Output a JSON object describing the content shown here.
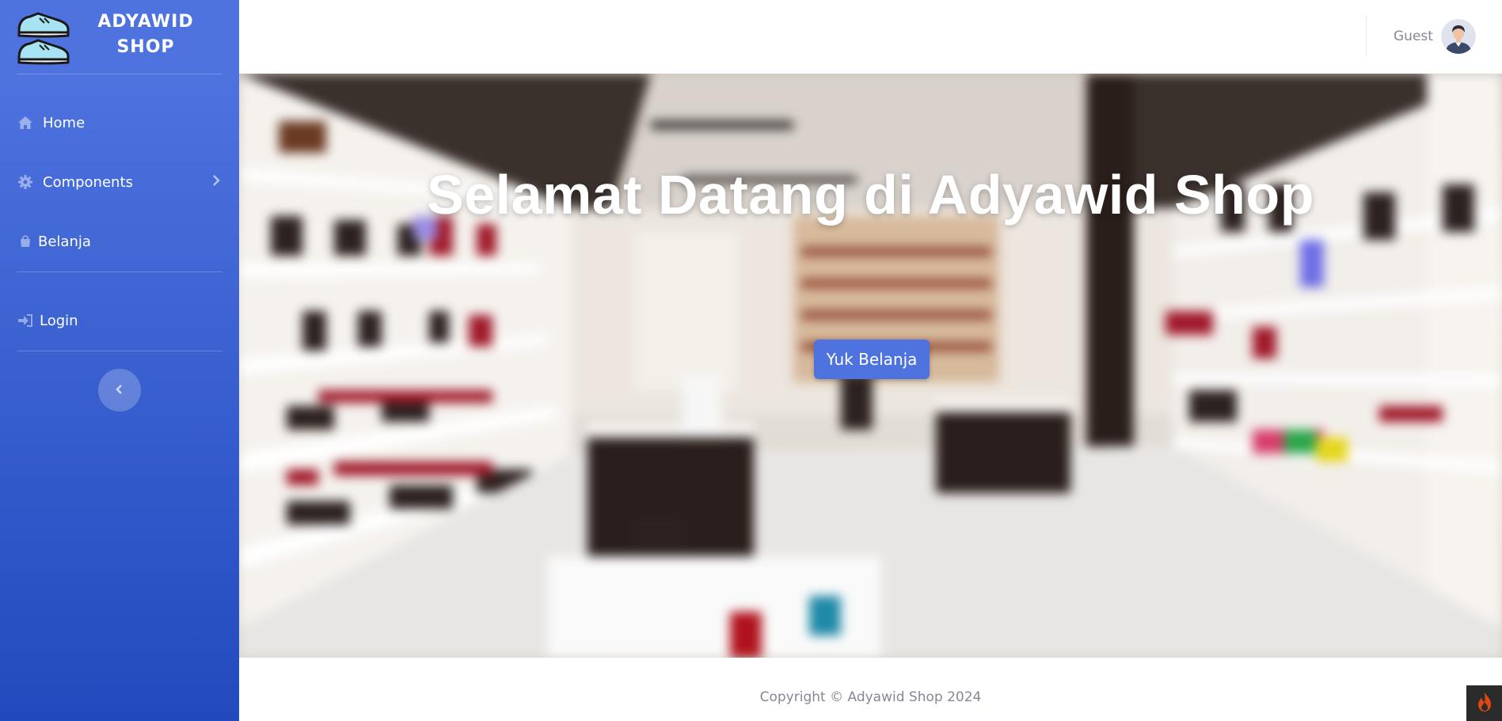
{
  "sidebar": {
    "brand": {
      "line1": "ADYAWID",
      "line2": "SHOP",
      "logo_icon": "sneakers-icon"
    },
    "items": [
      {
        "label": "Home",
        "icon": "home-icon"
      },
      {
        "label": "Components",
        "icon": "gear-icon",
        "has_submenu": true
      },
      {
        "label": "Belanja",
        "icon": "shopping-bag-icon"
      },
      {
        "label": "Login",
        "icon": "sign-in-icon"
      }
    ],
    "toggle_icon": "chevron-left-icon"
  },
  "topbar": {
    "user_name": "Guest",
    "avatar_icon": "user-avatar-icon"
  },
  "hero": {
    "title": "Selamat Datang di Adyawid Shop",
    "button_label": "Yuk Belanja"
  },
  "footer": {
    "copyright": "Copyright © Adyawid Shop 2024"
  },
  "colors": {
    "primary": "#4e73df",
    "sidebar_gradient_top": "#4e73df",
    "sidebar_gradient_bottom": "#224abe",
    "muted_text": "#858796"
  }
}
